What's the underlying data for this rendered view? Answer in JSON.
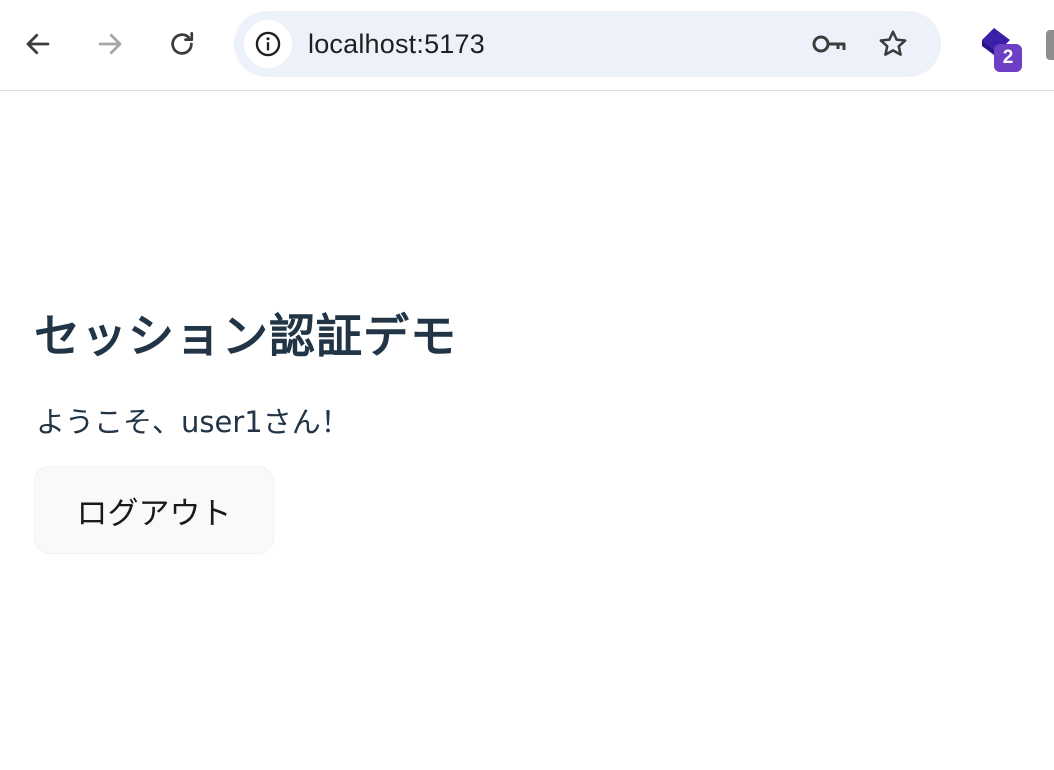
{
  "browser": {
    "url": "localhost:5173",
    "extension_badge": "2",
    "icons": {
      "back": "arrow-left-icon",
      "forward": "arrow-right-icon",
      "reload": "reload-icon",
      "site_info": "info-icon",
      "password": "key-icon",
      "bookmark": "star-icon",
      "extension": "extension-icon"
    },
    "colors": {
      "omnibox_bg": "#edf2fa",
      "badge_bg": "#6c3fc5",
      "extension_icon": "#3b1fa8"
    }
  },
  "page": {
    "title": "セッション認証デモ",
    "welcome": "ようこそ、user1さん！",
    "logout_label": "ログアウト",
    "colors": {
      "text": "#213547",
      "button_bg": "#f9f9f9"
    }
  }
}
